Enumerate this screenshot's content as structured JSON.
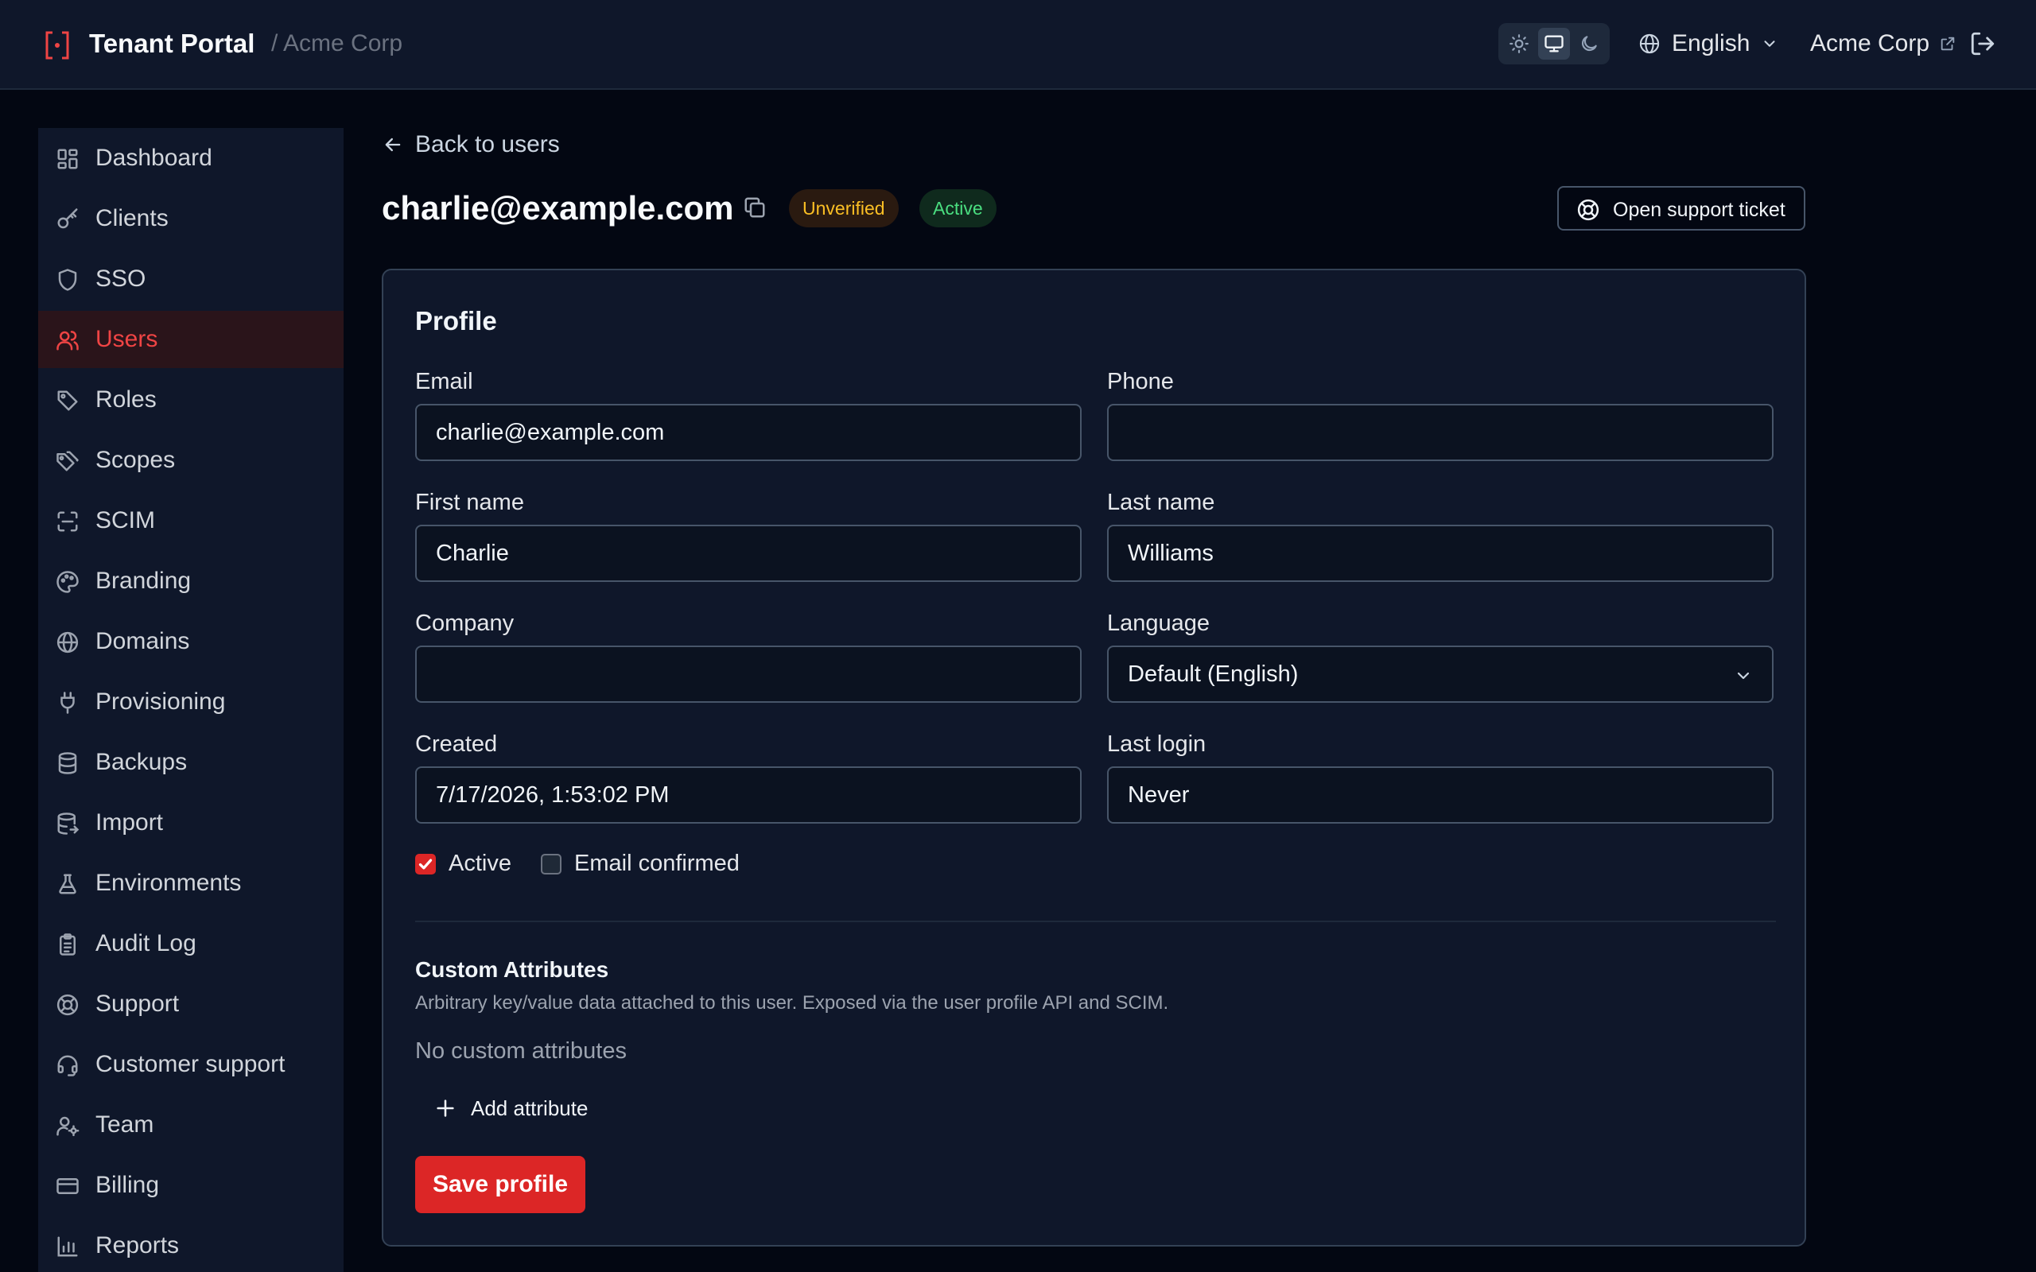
{
  "header": {
    "title": "Tenant Portal",
    "breadcrumb": "/ Acme Corp",
    "theme_options": [
      "light",
      "system",
      "dark"
    ],
    "theme_selected": "system",
    "language": "English",
    "org_name": "Acme Corp"
  },
  "sidebar": {
    "items": [
      {
        "label": "Dashboard",
        "icon": "dashboard-icon"
      },
      {
        "label": "Clients",
        "icon": "key-icon"
      },
      {
        "label": "SSO",
        "icon": "shield-icon"
      },
      {
        "label": "Users",
        "icon": "users-icon",
        "active": true
      },
      {
        "label": "Roles",
        "icon": "tag-icon"
      },
      {
        "label": "Scopes",
        "icon": "tags-icon"
      },
      {
        "label": "SCIM",
        "icon": "scan-icon"
      },
      {
        "label": "Branding",
        "icon": "palette-icon"
      },
      {
        "label": "Domains",
        "icon": "globe-icon"
      },
      {
        "label": "Provisioning",
        "icon": "plug-icon"
      },
      {
        "label": "Backups",
        "icon": "database-icon"
      },
      {
        "label": "Import",
        "icon": "database-import-icon"
      },
      {
        "label": "Environments",
        "icon": "flask-icon"
      },
      {
        "label": "Audit Log",
        "icon": "clipboard-icon"
      },
      {
        "label": "Support",
        "icon": "life-buoy-icon"
      },
      {
        "label": "Customer support",
        "icon": "headset-icon"
      },
      {
        "label": "Team",
        "icon": "team-icon"
      },
      {
        "label": "Billing",
        "icon": "credit-card-icon"
      },
      {
        "label": "Reports",
        "icon": "bar-chart-icon"
      }
    ]
  },
  "main": {
    "back_label": "Back to users",
    "user_email": "charlie@example.com",
    "badge_verification": "Unverified",
    "badge_status": "Active",
    "support_button": "Open support ticket",
    "profile": {
      "section_title": "Profile",
      "email_label": "Email",
      "email_value": "charlie@example.com",
      "phone_label": "Phone",
      "phone_value": "",
      "first_name_label": "First name",
      "first_name_value": "Charlie",
      "last_name_label": "Last name",
      "last_name_value": "Williams",
      "company_label": "Company",
      "company_value": "",
      "language_label": "Language",
      "language_value": "Default (English)",
      "created_label": "Created",
      "created_value": "7/17/2026, 1:53:02 PM",
      "last_login_label": "Last login",
      "last_login_value": "Never",
      "active_label": "Active",
      "active_checked": true,
      "email_confirmed_label": "Email confirmed",
      "email_confirmed_checked": false
    },
    "custom_attributes": {
      "title": "Custom Attributes",
      "description": "Arbitrary key/value data attached to this user. Exposed via the user profile API and SCIM.",
      "empty_text": "No custom attributes",
      "add_label": "Add attribute"
    },
    "save_label": "Save profile"
  },
  "colors": {
    "accent": "#dc2626",
    "background": "#030712",
    "panel": "#0f172a",
    "warning": "#fbbf24",
    "success": "#4ade80"
  }
}
